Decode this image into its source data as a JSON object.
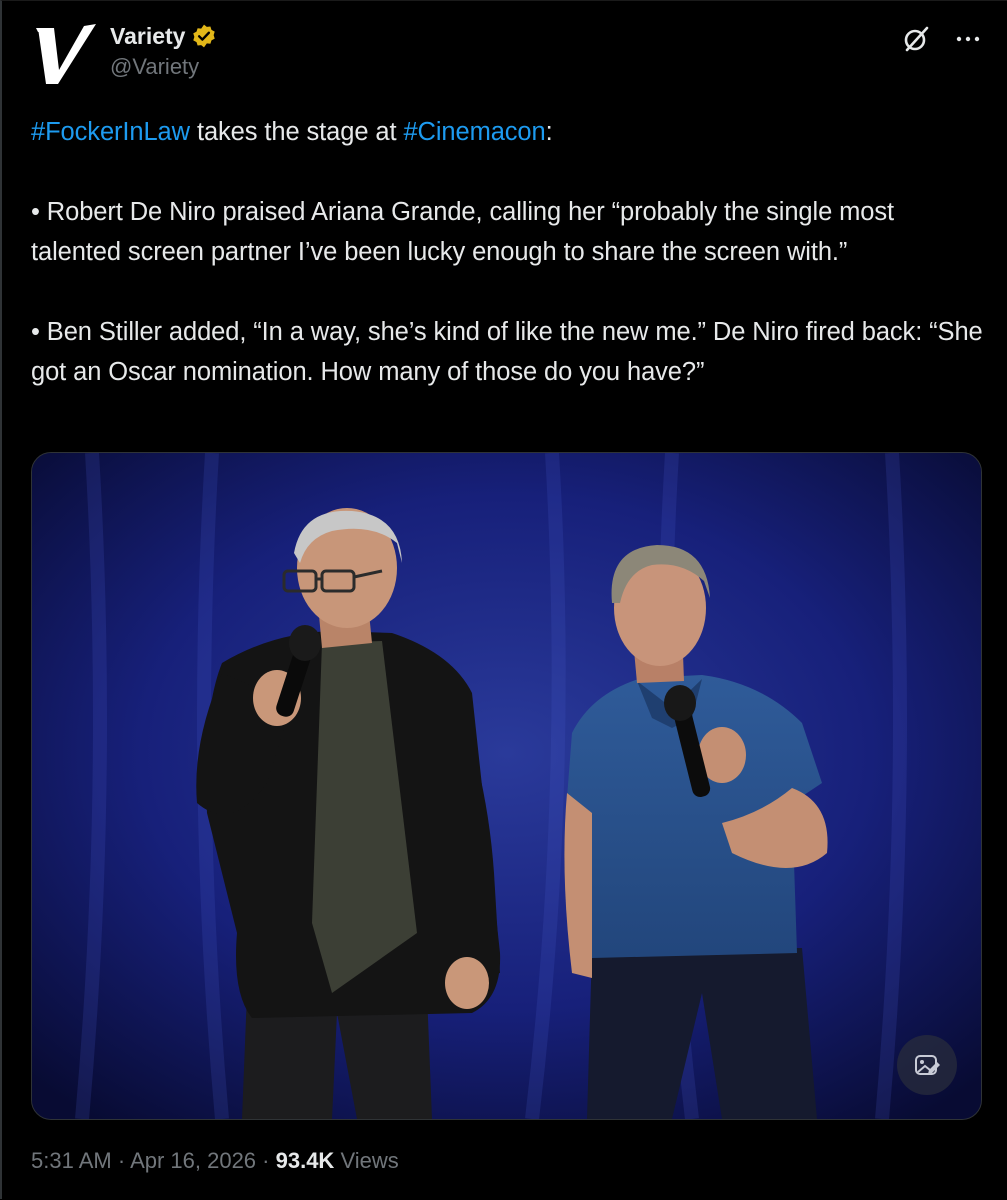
{
  "author": {
    "display_name": "Variety",
    "handle": "@Variety",
    "avatar_icon": "variety-v-logo",
    "verified_icon": "verified-gold-badge"
  },
  "header_actions": {
    "grok_icon": "grok-icon",
    "more_icon": "more-icon"
  },
  "tweet": {
    "line1": {
      "hashtag1": "#FockerInLaw",
      "middle": " takes the stage at ",
      "hashtag2": "#Cinemacon",
      "end": ":"
    },
    "paragraph2": "• Robert De Niro praised Ariana Grande, calling her “probably the single most talented screen partner I’ve been lucky enough to share the screen with.”",
    "paragraph3": "• Ben Stiller added, “In a way, she’s kind of like the new me.” De Niro fired back: “She got an Oscar nomination. How many of those do you have?”"
  },
  "media": {
    "alt_badge_icon": "image-edit-icon"
  },
  "meta": {
    "time": "5:31 AM",
    "sep1": " · ",
    "date": "Apr 16, 2026",
    "sep2": " · ",
    "views_count": "93.4K",
    "views_label": " Views"
  },
  "colors": {
    "background": "#000000",
    "text": "#e7e9ea",
    "muted": "#71767b",
    "link": "#1d9bf0",
    "verified": "#e2b719",
    "stage_backdrop": "#0d1347"
  }
}
